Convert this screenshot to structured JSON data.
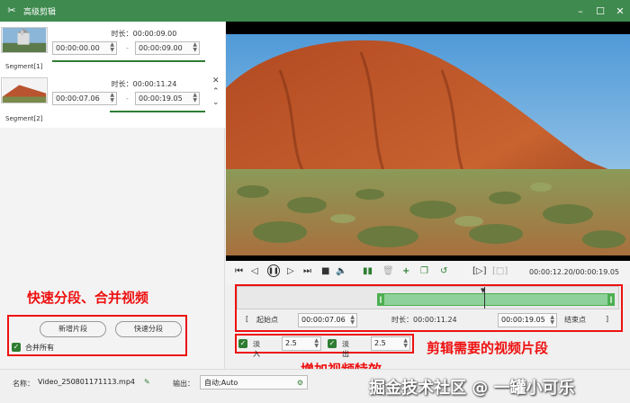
{
  "window": {
    "title": "高级剪辑"
  },
  "segments": [
    {
      "label": "Segment[1]",
      "duration": "时长：00:00:09.00",
      "start": "00:00:00.00",
      "end": "00:00:09.00"
    },
    {
      "label": "Segment[2]",
      "duration": "时长：00:00:11.24",
      "start": "00:00:07.06",
      "end": "00:00:19.05"
    }
  ],
  "range_separator": "-",
  "left_controls": {
    "new_segment": "新增片段",
    "quick_split": "快速分段",
    "merge_all": "合并所有"
  },
  "player": {
    "time_readout": "00:00:12.20/00:00:19.05"
  },
  "range": {
    "start_label": "起始点",
    "start_value": "00:00:07.06",
    "duration": "时长：00:00:11.24",
    "end_value": "00:00:19.05",
    "end_label": "结束点"
  },
  "effects": {
    "fade_in_label": "淡入",
    "fade_in_value": "2.5",
    "fade_out_label": "淡出",
    "fade_out_value": "2.5"
  },
  "annotations": {
    "split_merge": "快速分段、合并视频",
    "clip_segments": "剪辑需要的视频片段",
    "add_effects": "增加视频特效"
  },
  "bottom": {
    "name_label": "名称：",
    "file_name": "Video_250801171113.mp4",
    "output_label": "输出：",
    "output_value": "自动;Auto"
  },
  "watermark": "掘金技术社区 @ 一罐小可乐",
  "colors": {
    "titlebar": "#3f8a4f",
    "accent_green": "#2e7d32",
    "annotation_red": "#e11111",
    "timeline_selection": "#8fd19a"
  }
}
